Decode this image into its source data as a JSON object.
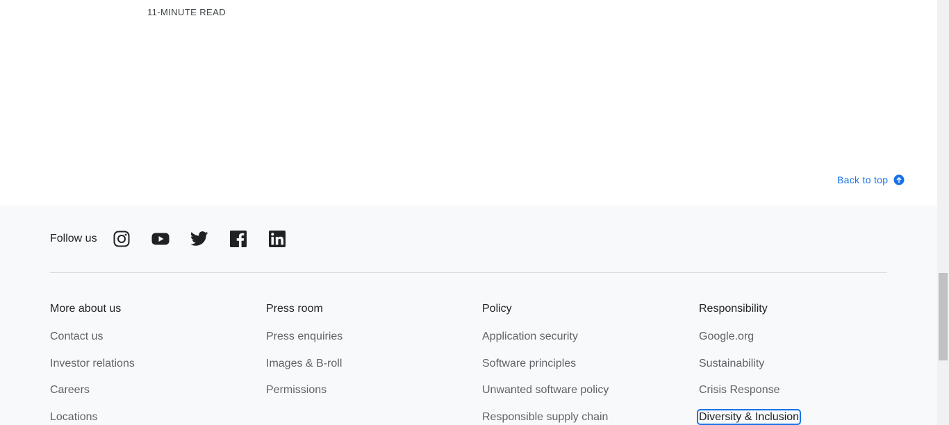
{
  "article": {
    "read_time": "11-MINUTE READ"
  },
  "back_to_top": {
    "label": "Back to top",
    "icon": "arrow-up-circle-icon",
    "color": "#1a73e8"
  },
  "footer": {
    "follow_label": "Follow us",
    "social": [
      {
        "name": "instagram-icon"
      },
      {
        "name": "youtube-icon"
      },
      {
        "name": "twitter-icon"
      },
      {
        "name": "facebook-icon"
      },
      {
        "name": "linkedin-icon"
      }
    ],
    "columns": [
      {
        "title": "More about us",
        "links": [
          "Contact us",
          "Investor relations",
          "Careers",
          "Locations"
        ]
      },
      {
        "title": "Press room",
        "links": [
          "Press enquiries",
          "Images & B-roll",
          "Permissions"
        ]
      },
      {
        "title": "Policy",
        "links": [
          "Application security",
          "Software principles",
          "Unwanted software policy",
          "Responsible supply chain"
        ]
      },
      {
        "title": "Responsibility",
        "links": [
          "Google.org",
          "Sustainability",
          "Crisis Response",
          "Diversity & Inclusion"
        ]
      }
    ]
  }
}
